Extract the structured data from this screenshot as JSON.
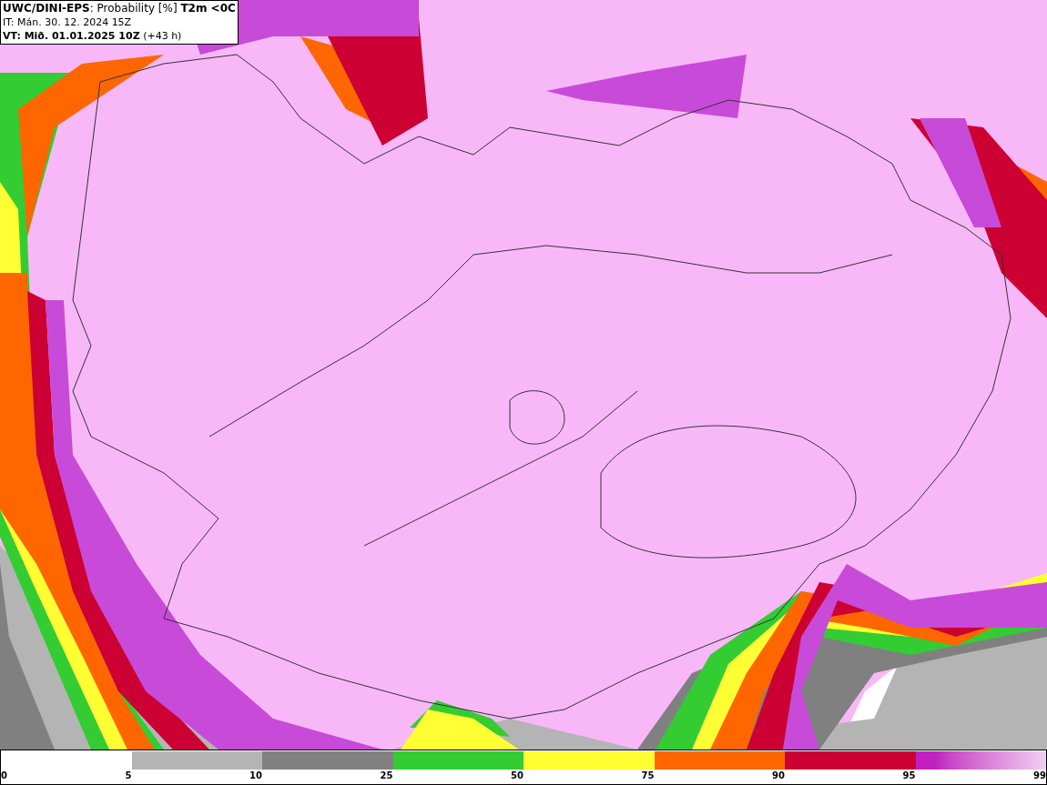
{
  "header": {
    "title": "**UWC/DINI-EPS**: Probability [%] **T2m <0C**",
    "init_time": "IT: Mán. 30. 12. 2024 15Z",
    "valid_time": "**VT: Mið. 01.01.2025 10Z** (+43 h)"
  },
  "legend": {
    "start_label": "0",
    "segments": [
      {
        "color": "#ffffff",
        "end_label": "5"
      },
      {
        "color": "#b4b4b4",
        "end_label": "10"
      },
      {
        "color": "#808080",
        "end_label": "25"
      },
      {
        "color": "#33cc33",
        "end_label": "50"
      },
      {
        "color": "#ffff33",
        "end_label": "75"
      },
      {
        "color": "#ff6600",
        "end_label": "90"
      },
      {
        "color": "#cc0033",
        "end_label": "95"
      },
      {
        "color": "#c020c0",
        "kind": "gradient",
        "end_label": "99"
      }
    ]
  }
}
